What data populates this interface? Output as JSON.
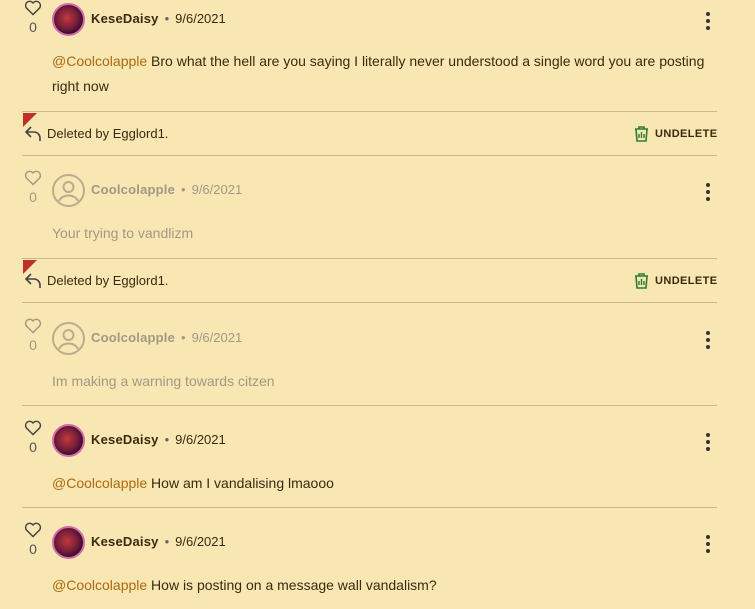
{
  "posts": [
    {
      "author": "KeseDaisy",
      "date": "9/6/2021",
      "likes": "0",
      "mention": "@Coolcolapple",
      "text": " Bro what the hell are you saying I literally never understood a single word you are posting right now"
    },
    {
      "author": "Coolcolapple",
      "date": "9/6/2021",
      "likes": "0",
      "text": "Your trying to vandlizm"
    },
    {
      "author": "Coolcolapple",
      "date": "9/6/2021",
      "likes": "0",
      "text": "Im making a warning towards citzen"
    },
    {
      "author": "KeseDaisy",
      "date": "9/6/2021",
      "likes": "0",
      "mention": "@Coolcolapple",
      "text": " How am I vandalising lmaooo"
    },
    {
      "author": "KeseDaisy",
      "date": "9/6/2021",
      "likes": "0",
      "mention": "@Coolcolapple",
      "text": " How is posting on a message wall vandalism?"
    }
  ],
  "deleted_banners": [
    {
      "text": "Deleted by Egglord1.",
      "action": "UNDELETE"
    },
    {
      "text": "Deleted by Egglord1.",
      "action": "UNDELETE"
    }
  ],
  "colors": {
    "background": "#f8e6b3",
    "mention": "#b06a10",
    "flag": "#c0302a",
    "undelete_icon": "#2e7d32"
  }
}
